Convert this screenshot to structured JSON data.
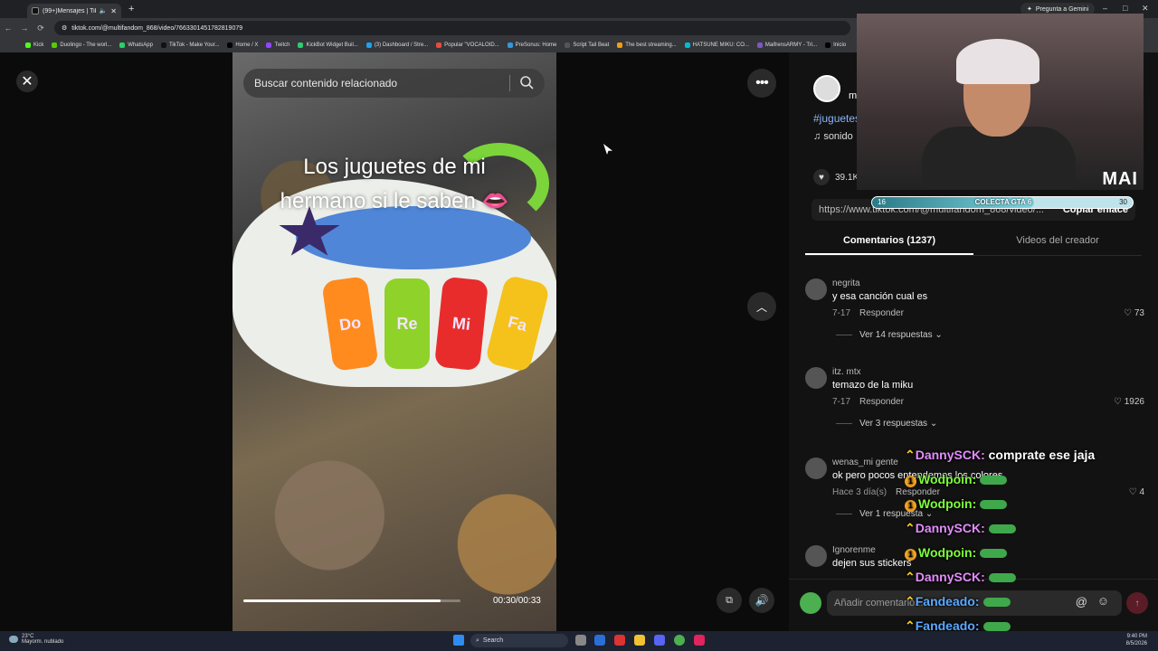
{
  "browser": {
    "tab_title": "(99+)Mensajes | TikTok",
    "url": "tiktok.com/@multifandom_868/video/7663301451782819079",
    "gemini_label": "Pregunta a Gemini",
    "bookmarks": [
      "Kick",
      "Duolingo - The worl...",
      "WhatsApp",
      "TikTok - Make Your...",
      "Home / X",
      "Twitch",
      "KickBot Widget Buil...",
      "(3) Dashboard / Stre...",
      "Popular \"VOCALOID...",
      "PreSonus: Home",
      "Script Tail Beat",
      "The best streaming...",
      "HATSUNE MIKU: CO...",
      "MaifrensARMY - Tri...",
      "Inicio"
    ]
  },
  "video": {
    "search_placeholder": "Buscar contenido relacionado",
    "caption_line1": "Los juguetes de mi",
    "caption_line2": "hermano si le saben 👄",
    "keys": [
      "Do",
      "Re",
      "Mi",
      "Fa"
    ],
    "time": "00:30/00:33",
    "progress": 0.91
  },
  "post": {
    "author": "m",
    "hashtag": "#juguetes",
    "sound": "sonido",
    "likes": "39.1K",
    "link": "https://www.tiktok.com/@multifandom_868/video/...",
    "copy_link": "Copiar enlace"
  },
  "tabs": {
    "comments": "Comentarios (1237)",
    "creator_videos": "Videos del creador"
  },
  "comments": [
    {
      "user": "negrita",
      "text": "y esa canción cual es",
      "date": "7-17",
      "reply": "Responder",
      "likes": "73",
      "replies": "Ver 14 respuestas ⌄"
    },
    {
      "user": "itz. mtx",
      "text": "temazo de la miku",
      "date": "7-17",
      "reply": "Responder",
      "likes": "1926",
      "replies": "Ver 3 respuestas ⌄"
    },
    {
      "user": "wenas_mi gente",
      "text": "ok pero pocos entendemos los colores",
      "date": "Hace 3 día(s)",
      "reply": "Responder",
      "likes": "4",
      "replies": "Ver 1 respuesta ⌄"
    },
    {
      "user": "Ignorenme",
      "text": "dejen sus stickers",
      "date": "",
      "reply": "",
      "likes": "",
      "replies": ""
    }
  ],
  "composer": {
    "placeholder": "Añadir comentario..."
  },
  "stream": {
    "goal_left": "16",
    "goal_label": "COLECTA GTA 6",
    "goal_right": "30",
    "goal_fraction": 0.62,
    "webcam_logo": "MAI",
    "chat": [
      {
        "user": "DannySCK:",
        "msg": "comprate ese jaja",
        "user_color": "#e58cff"
      },
      {
        "user": "Wodpoin:",
        "msg": "",
        "user_color": "#7dff3a"
      },
      {
        "user": "Wodpoin:",
        "msg": "",
        "user_color": "#7dff3a"
      },
      {
        "user": "DannySCK:",
        "msg": "",
        "user_color": "#e58cff"
      },
      {
        "user": "Wodpoin:",
        "msg": "",
        "user_color": "#7dff3a"
      },
      {
        "user": "DannySCK:",
        "msg": "",
        "user_color": "#e58cff"
      },
      {
        "user": "Fandeado:",
        "msg": "",
        "user_color": "#5aa9ff"
      },
      {
        "user": "Fandeado:",
        "msg": "",
        "user_color": "#5aa9ff"
      }
    ]
  },
  "taskbar": {
    "temp": "23°C",
    "weather": "Mayorm. nublado",
    "search": "Search",
    "time": "9:40 PM",
    "date": "8/5/2026"
  }
}
